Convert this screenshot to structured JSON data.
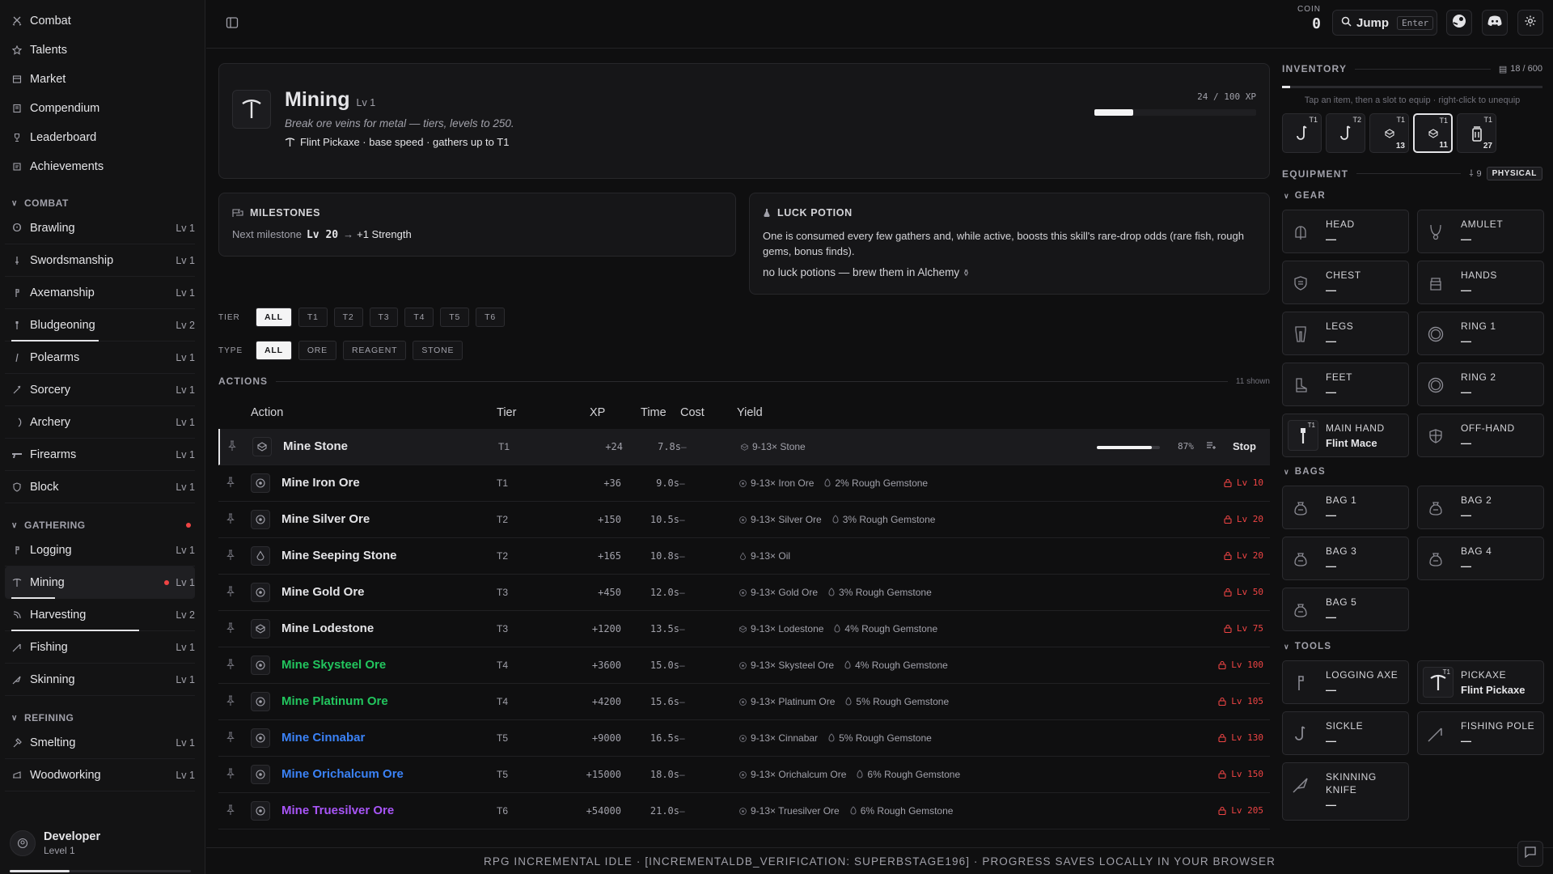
{
  "sidebar": {
    "top_links": [
      {
        "label": "Combat",
        "icon": "swords-icon"
      },
      {
        "label": "Talents",
        "icon": "star-icon"
      },
      {
        "label": "Market",
        "icon": "market-icon"
      },
      {
        "label": "Compendium",
        "icon": "book-icon"
      },
      {
        "label": "Leaderboard",
        "icon": "trophy-icon"
      },
      {
        "label": "Achievements",
        "icon": "medal-icon"
      }
    ],
    "sections": [
      {
        "title": "COMBAT",
        "skills": [
          {
            "label": "Brawling",
            "level": "Lv 1"
          },
          {
            "label": "Swordsmanship",
            "level": "Lv 1"
          },
          {
            "label": "Axemanship",
            "level": "Lv 1"
          },
          {
            "label": "Bludgeoning",
            "level": "Lv 2"
          },
          {
            "label": "Polearms",
            "level": "Lv 1"
          },
          {
            "label": "Sorcery",
            "level": "Lv 1"
          },
          {
            "label": "Archery",
            "level": "Lv 1"
          },
          {
            "label": "Firearms",
            "level": "Lv 1"
          },
          {
            "label": "Block",
            "level": "Lv 1"
          }
        ]
      },
      {
        "title": "GATHERING",
        "skills": [
          {
            "label": "Logging",
            "level": "Lv 1"
          },
          {
            "label": "Mining",
            "level": "Lv 1"
          },
          {
            "label": "Harvesting",
            "level": "Lv 2"
          },
          {
            "label": "Fishing",
            "level": "Lv 1"
          },
          {
            "label": "Skinning",
            "level": "Lv 1"
          }
        ]
      },
      {
        "title": "REFINING",
        "skills": [
          {
            "label": "Smelting",
            "level": "Lv 1"
          },
          {
            "label": "Woodworking",
            "level": "Lv 1"
          }
        ]
      }
    ],
    "progress": {
      "bludgeoning": 0.48,
      "mining": 0.24,
      "harvesting": 0.7
    },
    "user": {
      "name": "Developer",
      "level": "Level 1",
      "progress": 0.33
    }
  },
  "topbar": {
    "coin_label": "COIN",
    "coin_value": "0",
    "jump_label": "Jump",
    "jump_key": "Enter"
  },
  "skill": {
    "name": "Mining",
    "level": "Lv 1",
    "description": "Break ore veins for metal — tiers, levels to 250.",
    "tool_line": "Flint Pickaxe · base speed · gathers up to T1",
    "xp_text": "24 / 100 XP",
    "xp_fraction": 0.24
  },
  "milestones": {
    "title": "MILESTONES",
    "next_label": "Next milestone",
    "level": "Lv 20",
    "arrow": "→",
    "reward": "+1 Strength"
  },
  "luck": {
    "title": "LUCK POTION",
    "description": "One is consumed every few gathers and, while active, boosts this skill's rare-drop odds (rare fish, rough gems, bonus finds).",
    "none_text": "no luck potions — brew them in Alchemy"
  },
  "filters": {
    "tier_label": "TIER",
    "tiers": [
      "ALL",
      "T1",
      "T2",
      "T3",
      "T4",
      "T5",
      "T6"
    ],
    "type_label": "TYPE",
    "types": [
      "ALL",
      "ORE",
      "REAGENT",
      "STONE"
    ]
  },
  "actions": {
    "title": "ACTIONS",
    "count": "11 shown",
    "columns": {
      "action": "Action",
      "tier": "Tier",
      "xp": "XP",
      "time": "Time",
      "cost": "Cost",
      "yield": "Yield"
    },
    "active": {
      "progress": 0.87,
      "pct": "87%",
      "stop": "Stop"
    },
    "rows": [
      {
        "name": "Mine Stone",
        "tier": "T1",
        "xp": "+24",
        "time": "7.8s",
        "cost": "–",
        "yield": "9-13× Stone",
        "bonus": "",
        "lock": "",
        "color": "#e4e4e7",
        "icon": "stone-icon"
      },
      {
        "name": "Mine Iron Ore",
        "tier": "T1",
        "xp": "+36",
        "time": "9.0s",
        "cost": "–",
        "yield": "9-13× Iron Ore",
        "bonus": "2% Rough Gemstone",
        "lock": "Lv 10",
        "color": "#e4e4e7",
        "icon": "ore-icon"
      },
      {
        "name": "Mine Silver Ore",
        "tier": "T2",
        "xp": "+150",
        "time": "10.5s",
        "cost": "–",
        "yield": "9-13× Silver Ore",
        "bonus": "3% Rough Gemstone",
        "lock": "Lv 20",
        "color": "#e4e4e7",
        "icon": "ore-icon"
      },
      {
        "name": "Mine Seeping Stone",
        "tier": "T2",
        "xp": "+165",
        "time": "10.8s",
        "cost": "–",
        "yield": "9-13× Oil",
        "bonus": "",
        "lock": "Lv 20",
        "color": "#e4e4e7",
        "icon": "drop-icon"
      },
      {
        "name": "Mine Gold Ore",
        "tier": "T3",
        "xp": "+450",
        "time": "12.0s",
        "cost": "–",
        "yield": "9-13× Gold Ore",
        "bonus": "3% Rough Gemstone",
        "lock": "Lv 50",
        "color": "#e4e4e7",
        "icon": "ore-icon"
      },
      {
        "name": "Mine Lodestone",
        "tier": "T3",
        "xp": "+1200",
        "time": "13.5s",
        "cost": "–",
        "yield": "9-13× Lodestone",
        "bonus": "4% Rough Gemstone",
        "lock": "Lv 75",
        "color": "#e4e4e7",
        "icon": "stone-icon"
      },
      {
        "name": "Mine Skysteel Ore",
        "tier": "T4",
        "xp": "+3600",
        "time": "15.0s",
        "cost": "–",
        "yield": "9-13× Skysteel Ore",
        "bonus": "4% Rough Gemstone",
        "lock": "Lv 100",
        "color": "#22c55e",
        "icon": "ore-icon"
      },
      {
        "name": "Mine Platinum Ore",
        "tier": "T4",
        "xp": "+4200",
        "time": "15.6s",
        "cost": "–",
        "yield": "9-13× Platinum Ore",
        "bonus": "5% Rough Gemstone",
        "lock": "Lv 105",
        "color": "#22c55e",
        "icon": "ore-icon"
      },
      {
        "name": "Mine Cinnabar",
        "tier": "T5",
        "xp": "+9000",
        "time": "16.5s",
        "cost": "–",
        "yield": "9-13× Cinnabar",
        "bonus": "5% Rough Gemstone",
        "lock": "Lv 130",
        "color": "#3b82f6",
        "icon": "ore-icon"
      },
      {
        "name": "Mine Orichalcum Ore",
        "tier": "T5",
        "xp": "+15000",
        "time": "18.0s",
        "cost": "–",
        "yield": "9-13× Orichalcum Ore",
        "bonus": "6% Rough Gemstone",
        "lock": "Lv 150",
        "color": "#3b82f6",
        "icon": "ore-icon"
      },
      {
        "name": "Mine Truesilver Ore",
        "tier": "T6",
        "xp": "+54000",
        "time": "21.0s",
        "cost": "–",
        "yield": "9-13× Truesilver Ore",
        "bonus": "6% Rough Gemstone",
        "lock": "Lv 205",
        "color": "#a855f7",
        "icon": "ore-icon"
      }
    ]
  },
  "inventory": {
    "title": "INVENTORY",
    "count": "18 / 600",
    "fill": 0.03,
    "hint": "Tap an item, then a slot to equip · right-click to unequip",
    "items": [
      {
        "tier": "T1",
        "count": "",
        "icon": "sickle-icon"
      },
      {
        "tier": "T2",
        "count": "",
        "icon": "sickle-icon"
      },
      {
        "tier": "T1",
        "count": "13",
        "icon": "stone-icon"
      },
      {
        "tier": "T1",
        "count": "11",
        "icon": "stone-icon"
      },
      {
        "tier": "T1",
        "count": "27",
        "icon": "jar-icon"
      }
    ]
  },
  "equipment": {
    "title": "EQUIPMENT",
    "power": "9",
    "badge": "PHYSICAL",
    "gear_title": "GEAR",
    "gear": [
      {
        "label": "HEAD",
        "value": "—",
        "icon": "helmet-icon"
      },
      {
        "label": "AMULET",
        "value": "—",
        "icon": "amulet-icon"
      },
      {
        "label": "CHEST",
        "value": "—",
        "icon": "chest-armor-icon"
      },
      {
        "label": "HANDS",
        "value": "—",
        "icon": "gloves-icon"
      },
      {
        "label": "LEGS",
        "value": "—",
        "icon": "legs-icon"
      },
      {
        "label": "RING 1",
        "value": "—",
        "icon": "ring-icon"
      },
      {
        "label": "FEET",
        "value": "—",
        "icon": "boot-icon"
      },
      {
        "label": "RING 2",
        "value": "—",
        "icon": "ring-icon"
      },
      {
        "label": "MAIN HAND",
        "value": "Flint Mace",
        "icon": "mace-icon",
        "tier": "T1"
      },
      {
        "label": "OFF-HAND",
        "value": "—",
        "icon": "shield-icon"
      }
    ],
    "bags_title": "BAGS",
    "bags": [
      {
        "label": "BAG 1",
        "value": "—"
      },
      {
        "label": "BAG 2",
        "value": "—"
      },
      {
        "label": "BAG 3",
        "value": "—"
      },
      {
        "label": "BAG 4",
        "value": "—"
      },
      {
        "label": "BAG 5",
        "value": "—"
      }
    ],
    "tools_title": "TOOLS",
    "tools": [
      {
        "label": "LOGGING AXE",
        "value": "—",
        "icon": "axe-icon"
      },
      {
        "label": "PICKAXE",
        "value": "Flint Pickaxe",
        "icon": "pickaxe-icon",
        "tier": "T1"
      },
      {
        "label": "SICKLE",
        "value": "—",
        "icon": "sickle-icon"
      },
      {
        "label": "FISHING POLE",
        "value": "—",
        "icon": "fishing-pole-icon"
      },
      {
        "label": "SKINNING KNIFE",
        "value": "—",
        "icon": "knife-icon"
      }
    ]
  },
  "footer": {
    "text": "RPG INCREMENTAL IDLE · [INCREMENTALDB_VERIFICATION: SUPERBSTAGE196] · PROGRESS SAVES LOCALLY IN YOUR BROWSER"
  }
}
